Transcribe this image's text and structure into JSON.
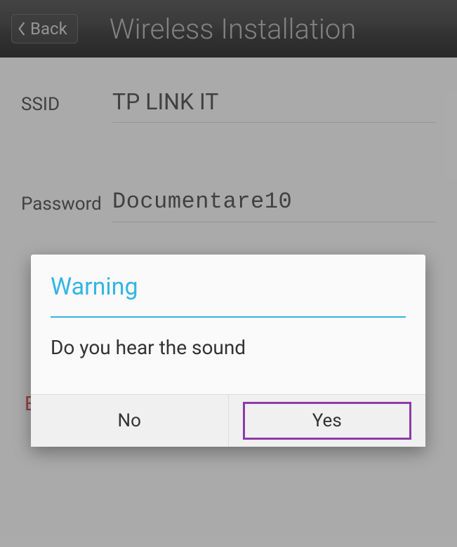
{
  "header": {
    "back_label": "Back",
    "title": "Wireless Installation"
  },
  "form": {
    "ssid_label": "SSID",
    "ssid_value": "TP LINK IT",
    "password_label": "Password",
    "password_value": "Documentare10"
  },
  "hidden_text": "E\np\np",
  "dialog": {
    "title": "Warning",
    "message": "Do you hear the sound",
    "no_label": "No",
    "yes_label": "Yes"
  }
}
